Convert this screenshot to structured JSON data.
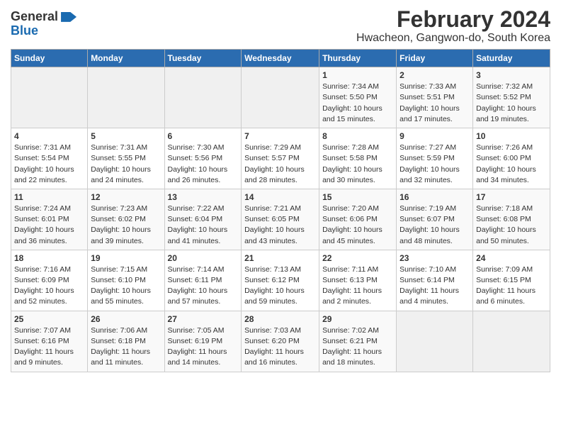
{
  "logo": {
    "general": "General",
    "blue": "Blue"
  },
  "header": {
    "title": "February 2024",
    "subtitle": "Hwacheon, Gangwon-do, South Korea"
  },
  "days_of_week": [
    "Sunday",
    "Monday",
    "Tuesday",
    "Wednesday",
    "Thursday",
    "Friday",
    "Saturday"
  ],
  "weeks": [
    [
      {
        "day": "",
        "info": ""
      },
      {
        "day": "",
        "info": ""
      },
      {
        "day": "",
        "info": ""
      },
      {
        "day": "",
        "info": ""
      },
      {
        "day": "1",
        "info": "Sunrise: 7:34 AM\nSunset: 5:50 PM\nDaylight: 10 hours\nand 15 minutes."
      },
      {
        "day": "2",
        "info": "Sunrise: 7:33 AM\nSunset: 5:51 PM\nDaylight: 10 hours\nand 17 minutes."
      },
      {
        "day": "3",
        "info": "Sunrise: 7:32 AM\nSunset: 5:52 PM\nDaylight: 10 hours\nand 19 minutes."
      }
    ],
    [
      {
        "day": "4",
        "info": "Sunrise: 7:31 AM\nSunset: 5:54 PM\nDaylight: 10 hours\nand 22 minutes."
      },
      {
        "day": "5",
        "info": "Sunrise: 7:31 AM\nSunset: 5:55 PM\nDaylight: 10 hours\nand 24 minutes."
      },
      {
        "day": "6",
        "info": "Sunrise: 7:30 AM\nSunset: 5:56 PM\nDaylight: 10 hours\nand 26 minutes."
      },
      {
        "day": "7",
        "info": "Sunrise: 7:29 AM\nSunset: 5:57 PM\nDaylight: 10 hours\nand 28 minutes."
      },
      {
        "day": "8",
        "info": "Sunrise: 7:28 AM\nSunset: 5:58 PM\nDaylight: 10 hours\nand 30 minutes."
      },
      {
        "day": "9",
        "info": "Sunrise: 7:27 AM\nSunset: 5:59 PM\nDaylight: 10 hours\nand 32 minutes."
      },
      {
        "day": "10",
        "info": "Sunrise: 7:26 AM\nSunset: 6:00 PM\nDaylight: 10 hours\nand 34 minutes."
      }
    ],
    [
      {
        "day": "11",
        "info": "Sunrise: 7:24 AM\nSunset: 6:01 PM\nDaylight: 10 hours\nand 36 minutes."
      },
      {
        "day": "12",
        "info": "Sunrise: 7:23 AM\nSunset: 6:02 PM\nDaylight: 10 hours\nand 39 minutes."
      },
      {
        "day": "13",
        "info": "Sunrise: 7:22 AM\nSunset: 6:04 PM\nDaylight: 10 hours\nand 41 minutes."
      },
      {
        "day": "14",
        "info": "Sunrise: 7:21 AM\nSunset: 6:05 PM\nDaylight: 10 hours\nand 43 minutes."
      },
      {
        "day": "15",
        "info": "Sunrise: 7:20 AM\nSunset: 6:06 PM\nDaylight: 10 hours\nand 45 minutes."
      },
      {
        "day": "16",
        "info": "Sunrise: 7:19 AM\nSunset: 6:07 PM\nDaylight: 10 hours\nand 48 minutes."
      },
      {
        "day": "17",
        "info": "Sunrise: 7:18 AM\nSunset: 6:08 PM\nDaylight: 10 hours\nand 50 minutes."
      }
    ],
    [
      {
        "day": "18",
        "info": "Sunrise: 7:16 AM\nSunset: 6:09 PM\nDaylight: 10 hours\nand 52 minutes."
      },
      {
        "day": "19",
        "info": "Sunrise: 7:15 AM\nSunset: 6:10 PM\nDaylight: 10 hours\nand 55 minutes."
      },
      {
        "day": "20",
        "info": "Sunrise: 7:14 AM\nSunset: 6:11 PM\nDaylight: 10 hours\nand 57 minutes."
      },
      {
        "day": "21",
        "info": "Sunrise: 7:13 AM\nSunset: 6:12 PM\nDaylight: 10 hours\nand 59 minutes."
      },
      {
        "day": "22",
        "info": "Sunrise: 7:11 AM\nSunset: 6:13 PM\nDaylight: 11 hours\nand 2 minutes."
      },
      {
        "day": "23",
        "info": "Sunrise: 7:10 AM\nSunset: 6:14 PM\nDaylight: 11 hours\nand 4 minutes."
      },
      {
        "day": "24",
        "info": "Sunrise: 7:09 AM\nSunset: 6:15 PM\nDaylight: 11 hours\nand 6 minutes."
      }
    ],
    [
      {
        "day": "25",
        "info": "Sunrise: 7:07 AM\nSunset: 6:16 PM\nDaylight: 11 hours\nand 9 minutes."
      },
      {
        "day": "26",
        "info": "Sunrise: 7:06 AM\nSunset: 6:18 PM\nDaylight: 11 hours\nand 11 minutes."
      },
      {
        "day": "27",
        "info": "Sunrise: 7:05 AM\nSunset: 6:19 PM\nDaylight: 11 hours\nand 14 minutes."
      },
      {
        "day": "28",
        "info": "Sunrise: 7:03 AM\nSunset: 6:20 PM\nDaylight: 11 hours\nand 16 minutes."
      },
      {
        "day": "29",
        "info": "Sunrise: 7:02 AM\nSunset: 6:21 PM\nDaylight: 11 hours\nand 18 minutes."
      },
      {
        "day": "",
        "info": ""
      },
      {
        "day": "",
        "info": ""
      }
    ]
  ]
}
